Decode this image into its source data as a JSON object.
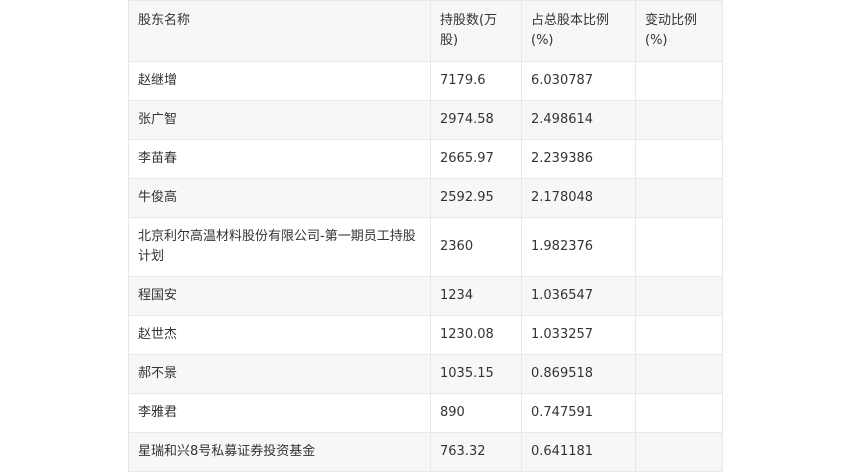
{
  "table": {
    "headers": [
      "股东名称",
      "持股数(万股)",
      "占总股本比例(%)",
      "变动比例(%)"
    ],
    "rows": [
      {
        "name": "赵继增",
        "shares": "7179.6",
        "ratio": "6.030787",
        "change": ""
      },
      {
        "name": "张广智",
        "shares": "2974.58",
        "ratio": "2.498614",
        "change": ""
      },
      {
        "name": "李苗春",
        "shares": "2665.97",
        "ratio": "2.239386",
        "change": ""
      },
      {
        "name": "牛俊高",
        "shares": "2592.95",
        "ratio": "2.178048",
        "change": ""
      },
      {
        "name": "北京利尔高温材料股份有限公司-第一期员工持股计划",
        "shares": "2360",
        "ratio": "1.982376",
        "change": ""
      },
      {
        "name": "程国安",
        "shares": "1234",
        "ratio": "1.036547",
        "change": ""
      },
      {
        "name": "赵世杰",
        "shares": "1230.08",
        "ratio": "1.033257",
        "change": ""
      },
      {
        "name": "郝不景",
        "shares": "1035.15",
        "ratio": "0.869518",
        "change": ""
      },
      {
        "name": "李雅君",
        "shares": "890",
        "ratio": "0.747591",
        "change": ""
      },
      {
        "name": "星瑞和兴8号私募证券投资基金",
        "shares": "763.32",
        "ratio": "0.641181",
        "change": ""
      }
    ]
  }
}
